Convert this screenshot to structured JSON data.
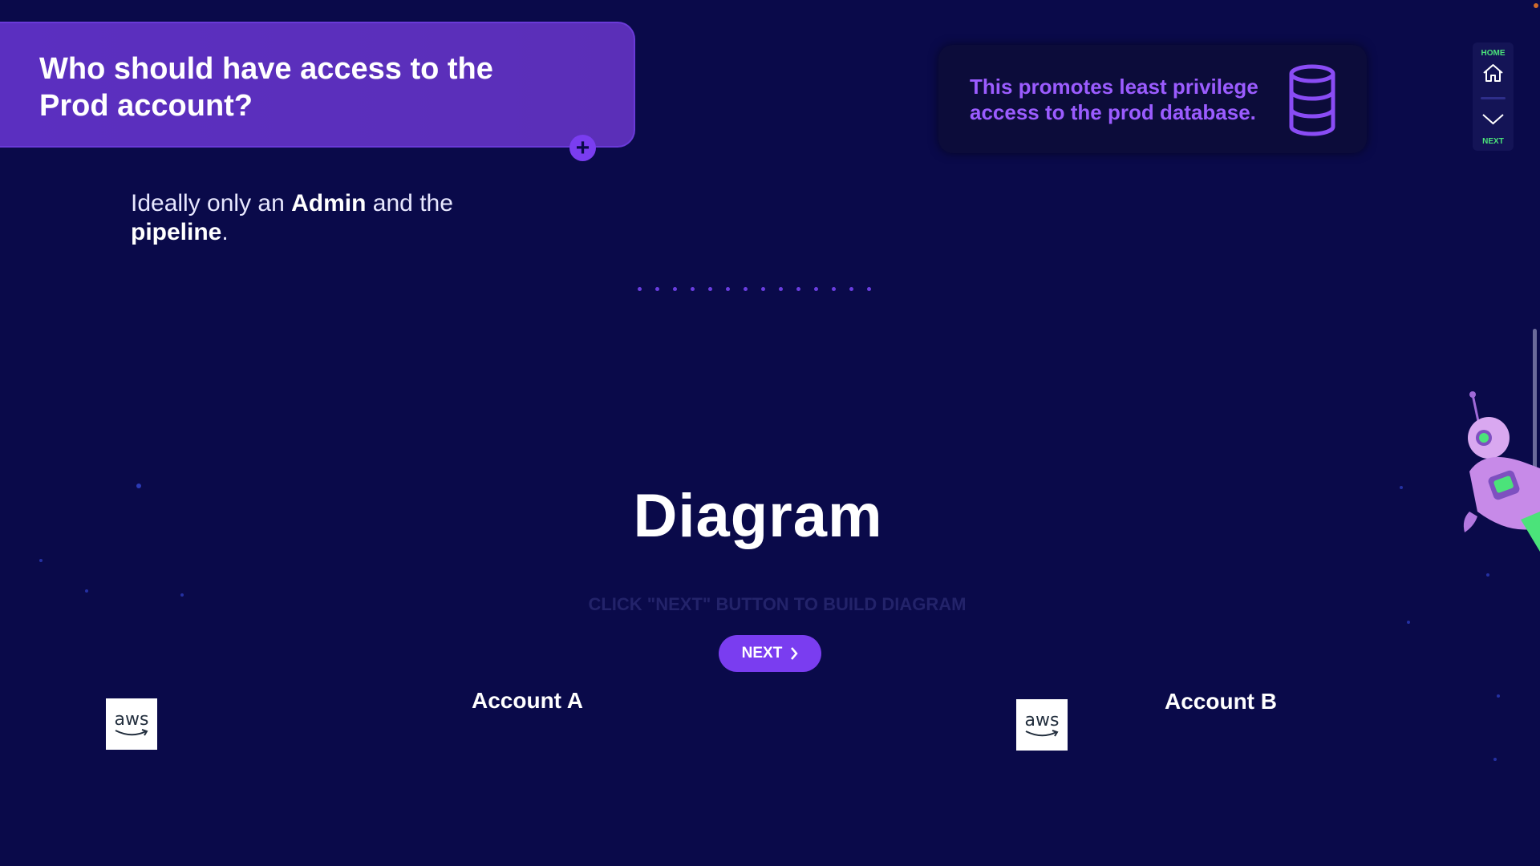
{
  "question": {
    "text": "Who should have access to the Prod account?",
    "expand_icon": "plus-icon"
  },
  "answer": {
    "prefix": "Ideally only an ",
    "bold1": "Admin",
    "middle": " and the ",
    "bold2": "pipeline",
    "suffix": "."
  },
  "callout": {
    "text": "This promotes least privilege access to the prod database.",
    "icon": "database-icon"
  },
  "side_nav": {
    "home_label": "HOME",
    "next_label": "NEXT",
    "home_icon": "home-icon",
    "next_icon": "chevron-down-icon"
  },
  "diagram": {
    "title": "Diagram",
    "hint": "CLICK \"NEXT\" BUTTON TO BUILD DIAGRAM",
    "next_button": "NEXT"
  },
  "accounts": [
    {
      "label": "Account A",
      "logo_text": "aws"
    },
    {
      "label": "Account B",
      "logo_text": "aws"
    }
  ],
  "colors": {
    "background": "#0a0a4a",
    "accent": "#7a3df0",
    "card": "#5b2fc0",
    "callout_text": "#9b5cff",
    "nav_label": "#4be37a"
  }
}
